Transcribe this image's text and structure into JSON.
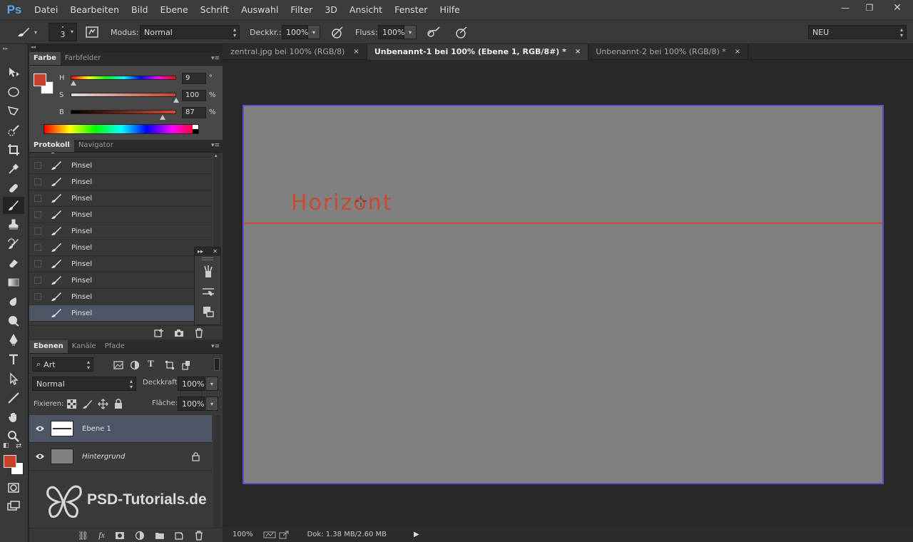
{
  "app": {
    "logo": "Ps"
  },
  "menu": [
    "Datei",
    "Bearbeiten",
    "Bild",
    "Ebene",
    "Schrift",
    "Auswahl",
    "Filter",
    "3D",
    "Ansicht",
    "Fenster",
    "Hilfe"
  ],
  "window_controls": {
    "minimize": "—",
    "restore": "❐",
    "close": "✕"
  },
  "options": {
    "brush_size": "3",
    "mode_label": "Modus:",
    "mode_value": "Normal",
    "opacity_label": "Deckkr.:",
    "opacity_value": "100%",
    "flow_label": "Fluss:",
    "flow_value": "100%",
    "workspace": "NEU"
  },
  "color_panel": {
    "tabs": [
      "Farbe",
      "Farbfelder"
    ],
    "h": {
      "label": "H",
      "value": "9",
      "unit": "°",
      "fraction": 0.025
    },
    "s": {
      "label": "S",
      "value": "100",
      "unit": "%",
      "fraction": 1.0
    },
    "b": {
      "label": "B",
      "value": "87",
      "unit": "%",
      "fraction": 0.87
    },
    "foreground": "#c8422a",
    "background": "#ffffff"
  },
  "history_panel": {
    "tabs": [
      "Protokoll",
      "Navigator"
    ],
    "items": [
      "Pinsel",
      "Pinsel",
      "Pinsel",
      "Pinsel",
      "Pinsel",
      "Pinsel",
      "Pinsel",
      "Pinsel",
      "Pinsel",
      "Pinsel",
      "Pinsel"
    ],
    "selected_index": 10
  },
  "layers_panel": {
    "tabs": [
      "Ebenen",
      "Kanäle",
      "Pfade"
    ],
    "filter_kind": "Art",
    "blend_mode": "Normal",
    "opacity_label": "Deckkraft:",
    "opacity_value": "100%",
    "lock_label": "Fixieren:",
    "fill_label": "Fläche:",
    "fill_value": "100%",
    "layers": [
      {
        "name": "Ebene 1",
        "selected": true,
        "italic": false,
        "locked": false
      },
      {
        "name": "Hintergrund",
        "selected": false,
        "italic": true,
        "locked": true
      }
    ]
  },
  "doc_tabs": [
    {
      "label": "zentral.jpg bei 100% (RGB/8)",
      "active": false,
      "close": "×"
    },
    {
      "label": "Unbenannt-1 bei 100% (Ebene 1, RGB/8#) *",
      "active": true,
      "close": "×"
    },
    {
      "label": "Unbenannt-2 bei 100% (RGB/8) *",
      "active": false,
      "close": "×"
    }
  ],
  "canvas": {
    "text": "Horizont",
    "ink_color": "#c84a30",
    "border_color": "#5a4fcf"
  },
  "status": {
    "zoom": "100%",
    "doc_info": "Dok: 1.38 MB/2.60 MB"
  },
  "watermark": "PSD-Tutorials.de"
}
